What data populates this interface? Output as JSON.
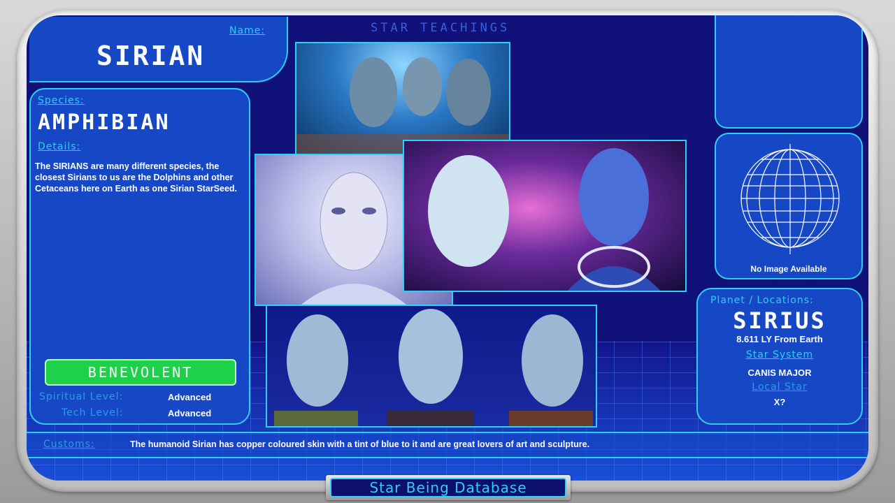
{
  "header": {
    "title": "STAR TEACHINGS"
  },
  "name_panel": {
    "label": "Name:",
    "value": "SIRIAN"
  },
  "species_panel": {
    "species_label": "Species:",
    "species_value": "AMPHIBIAN",
    "details_label": "Details:",
    "details_text": "The SIRIANS are many different species, the closest Sirians to us are the Dolphins and other Cetaceans here on Earth as one Sirian StarSeed.",
    "alignment": "BENEVOLENT",
    "spiritual_label": "Spiritual Level:",
    "spiritual_value": "Advanced",
    "tech_label": "Tech Level:",
    "tech_value": "Advanced"
  },
  "globe_panel": {
    "caption": "No Image Available"
  },
  "planet_panel": {
    "label": "Planet / Locations:",
    "planet": "SIRIUS",
    "distance": "8.611 LY From Earth",
    "system_label": "Star System",
    "system_value": "CANIS MAJOR",
    "local_star_label": "Local Star",
    "local_star_value": "X?"
  },
  "customs": {
    "label": "Customs:",
    "text": "The humanoid Sirian has copper coloured skin with a tint of blue to it and are great lovers of art and sculpture."
  },
  "footer": {
    "title": "Star Being Database"
  },
  "colors": {
    "accent": "#2ad0f5",
    "panel": "#1648c6",
    "background": "#10127a",
    "benevolent": "#1fd04a"
  },
  "images": [
    {
      "name": "dolphins-photo",
      "icon": "dolphin-image"
    },
    {
      "name": "ethereal-being-photo",
      "icon": "portrait-image"
    },
    {
      "name": "blue-beings-cosmos-photo",
      "icon": "portrait-image"
    },
    {
      "name": "three-sirians-photo",
      "icon": "portrait-image"
    }
  ]
}
